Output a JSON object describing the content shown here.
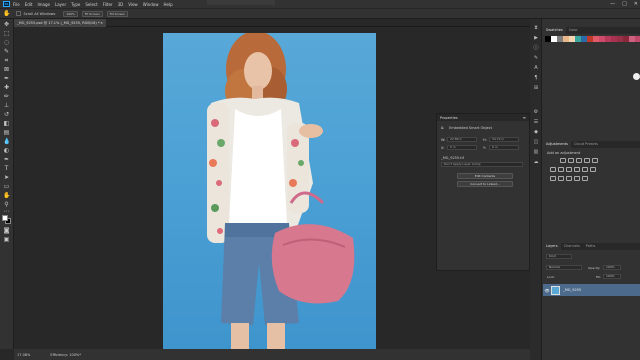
{
  "menubar": {
    "logo": "Ps",
    "items": [
      "File",
      "Edit",
      "Image",
      "Layer",
      "Type",
      "Select",
      "Filter",
      "3D",
      "View",
      "Window",
      "Help"
    ]
  },
  "window_controls": {
    "minimize": "—",
    "maximize": "□",
    "close": "✕"
  },
  "options": {
    "scroll_all_windows": "Scroll All Windows",
    "zoom_100": "100%",
    "fit_screen": "Fit Screen",
    "fill_screen": "Fill Screen"
  },
  "document_tab": {
    "title": "_MG_9255.psd @ 17.1% (_MG_9255, RGB/16) *",
    "close": "×"
  },
  "status": {
    "zoom": "17.08%",
    "efficiency": "Efficiency: 100%*"
  },
  "properties_panel": {
    "title": "Properties",
    "type_label": "Embedded Smart Object",
    "w_label": "W:",
    "w_value": "22.86 in",
    "h_label": "H:",
    "h_value": "34.72 in",
    "x_label": "X:",
    "x_value": "0 in",
    "y_label": "Y:",
    "y_value": "0 in",
    "filename": "_MG_9255.tif",
    "layer_comp_placeholder": "Don't Apply Layer Comp",
    "edit_contents": "Edit Contents",
    "convert_linked": "Convert to Linked..."
  },
  "swatches_panel": {
    "tabs": [
      "Swatches",
      "Color"
    ],
    "colors": [
      "#000000",
      "#ffffff",
      "#7f7f7f",
      "#e8b88a",
      "#f4d7b0",
      "#3aa6a0",
      "#2a6aa8",
      "#c0392b",
      "#e05a6a",
      "#d04a6a",
      "#b83a5a",
      "#a83050",
      "#983048",
      "#882838",
      "#d06080",
      "#c04868"
    ]
  },
  "adjustments_panel": {
    "tabs": [
      "Adjustments",
      "Cloud Presets"
    ],
    "heading": "Add an adjustment"
  },
  "layers_panel": {
    "tabs": [
      "Layers",
      "Channels",
      "Paths"
    ],
    "kind": "Kind",
    "blend_mode": "Normal",
    "opacity_label": "Opacity:",
    "opacity_value": "100%",
    "lock_label": "Lock:",
    "fill_label": "Fill:",
    "fill_value": "100%",
    "layer_name": "_MG_9255"
  }
}
